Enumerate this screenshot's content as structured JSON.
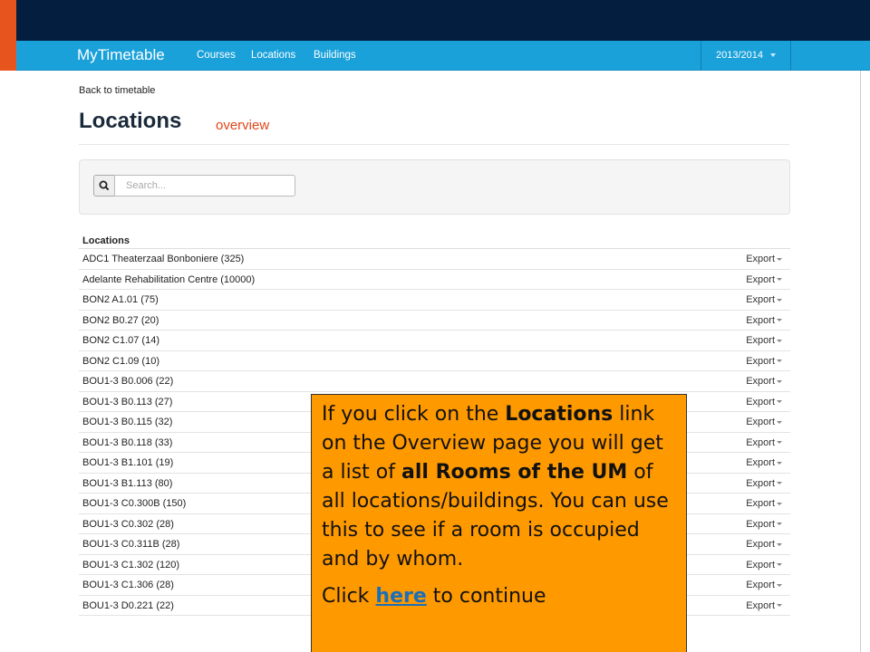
{
  "app": {
    "brand": "MyTimetable",
    "nav": [
      "Courses",
      "Locations",
      "Buildings"
    ],
    "year": "2013/2014"
  },
  "page": {
    "back_link": "Back to timetable",
    "title": "Locations",
    "subtitle": "overview"
  },
  "search": {
    "placeholder": "Search...",
    "value": ""
  },
  "table": {
    "header": "Locations",
    "action_label": "Export",
    "rows": [
      "ADC1 Theaterzaal Bonboniere (325)",
      "Adelante Rehabilitation Centre (10000)",
      "BON2 A1.01 (75)",
      "BON2 B0.27 (20)",
      "BON2 C1.07 (14)",
      "BON2 C1.09 (10)",
      "BOU1-3 B0.006 (22)",
      "BOU1-3 B0.113 (27)",
      "BOU1-3 B0.115 (32)",
      "BOU1-3 B0.118 (33)",
      "BOU1-3 B1.101 (19)",
      "BOU1-3 B1.113 (80)",
      "BOU1-3 C0.300B (150)",
      "BOU1-3 C0.302 (28)",
      "BOU1-3 C0.311B (28)",
      "BOU1-3 C1.302 (120)",
      "BOU1-3 C1.306 (28)",
      "BOU1-3 D0.221 (22)"
    ]
  },
  "callout": {
    "p1_a": "If you click on the ",
    "p1_b": "Locations",
    "p1_c": " link on the Overview page you will get a list of ",
    "p1_d": "all Rooms of the UM",
    "p1_e": " of all locations/buildings. You can use this to see if a room is occupied and by whom.",
    "p2_a": "Click ",
    "p2_link": "here",
    "p2_b": " to continue"
  },
  "colors": {
    "topbar": "#031e3f",
    "navbar": "#1aa1da",
    "accent_strip": "#e8541d",
    "subtitle": "#e1461b",
    "callout_bg": "#ff9900",
    "link": "#1b6fb8"
  }
}
